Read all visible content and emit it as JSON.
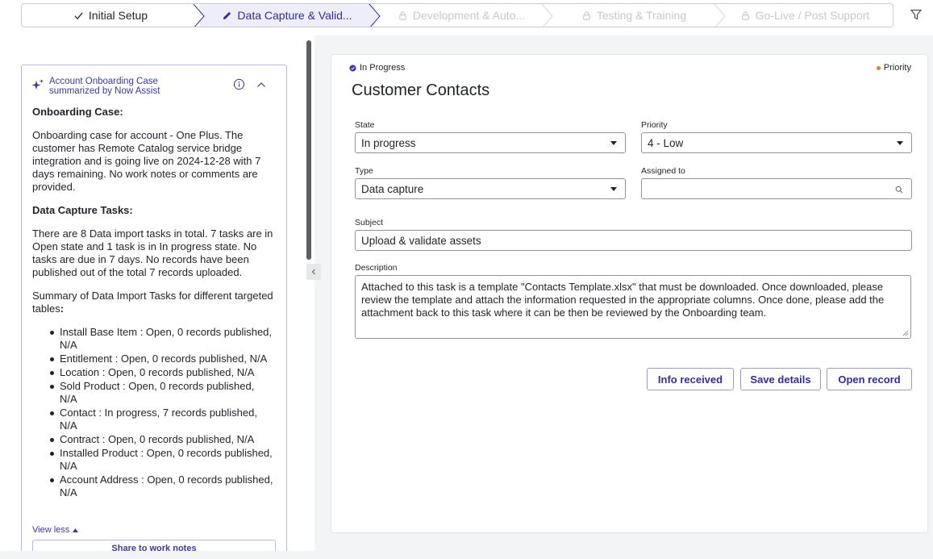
{
  "stepper": {
    "steps": [
      {
        "label": "Initial Setup",
        "state": "completed"
      },
      {
        "label": "Data Capture & Valid...",
        "state": "active"
      },
      {
        "label": "Development & Auto...",
        "state": "locked"
      },
      {
        "label": "Testing & Training",
        "state": "locked"
      },
      {
        "label": "Go-Live / Post Support",
        "state": "locked"
      }
    ],
    "filter_icon": "filter-icon"
  },
  "summary": {
    "title": "Account Onboarding Case summarized by Now Assist",
    "section1_heading": "Onboarding Case:",
    "section1_text": "Onboarding case for account - One Plus. The customer has Remote Catalog service bridge integration and is going live on 2024-12-28 with 7 days remaining. No work notes or comments are provided.",
    "section2_heading": "Data Capture Tasks:",
    "section2_text": "There are 8 Data import tasks in total. 7 tasks are in Open state and 1 task is in In progress state. No tasks are due in 7 days. No records have been published out of the total 7 records uploaded.",
    "section3_text": "Summary of Data Import Tasks for different targeted tables",
    "section3_colon": ":",
    "items": [
      "Install Base Item : Open, 0 records published, N/A",
      "Entitlement : Open, 0 records published, N/A",
      "Location : Open, 0 records published, N/A",
      "Sold Product : Open, 0 records published, N/A",
      "Contact : In progress, 7 records published, N/A",
      "Contract : Open, 0 records published, N/A",
      "Installed Product : Open, 0 records published, N/A",
      "Account Address : Open, 0 records published, N/A"
    ],
    "view_less": "View less",
    "share_button": "Share to work notes"
  },
  "form": {
    "status": "In Progress",
    "priority_badge": "Priority",
    "title": "Customer Contacts",
    "state_label": "State",
    "state_value": "In progress",
    "priority_label": "Priority",
    "priority_value": "4 - Low",
    "type_label": "Type",
    "type_value": "Data capture",
    "assigned_label": "Assigned to",
    "assigned_value": "",
    "subject_label": "Subject",
    "subject_value": "Upload & validate assets",
    "description_label": "Description",
    "description_value": "Attached to this task is a template \"Contacts Template.xlsx\" that must be downloaded. Once downloaded, please review the template and attach the information requested in the appropriate columns. Once done, please add the attachment back to this task where it can be then be reviewed by the Onboarding team.",
    "buttons": {
      "info_received": "Info received",
      "save_details": "Save details",
      "open_record": "Open record"
    }
  },
  "colors": {
    "accent": "#3b3a9f",
    "active_step_bg": "#eeeefb",
    "priority_dot": "#e2831c"
  }
}
